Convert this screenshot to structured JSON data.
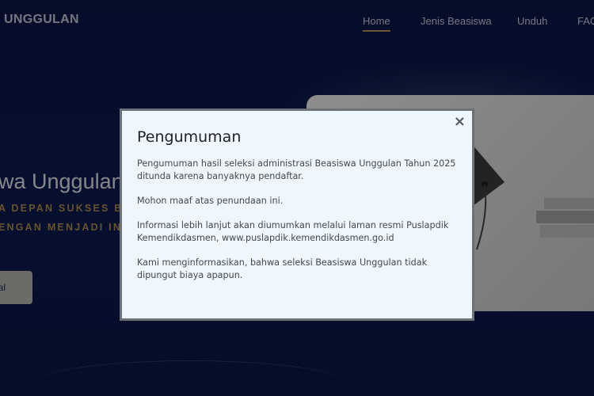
{
  "header": {
    "brand": "UNGGULAN",
    "nav": [
      {
        "label": "Home",
        "active": true
      },
      {
        "label": "Jenis Beasiswa",
        "active": false
      },
      {
        "label": "Unduh",
        "active": false
      },
      {
        "label": "FAQ",
        "active": false
      }
    ]
  },
  "hero": {
    "title": "wa Unggulan",
    "subtitle_line1": "A DEPAN SUKSES BERS",
    "subtitle_line2": "ENGAN MENJADI INSA",
    "button_label": "al"
  },
  "modal": {
    "title": "Pengumuman",
    "close_symbol": "×",
    "paragraphs": [
      "Pengumuman hasil seleksi administrasi Beasiswa Unggulan Tahun 2025 ditunda karena banyaknya pendaftar.",
      "Mohon maaf atas penundaan ini.",
      "Informasi lebih lanjut akan diumumkan melalui laman resmi Puslapdik Kemendikdasmen, www.puslapdik.kemendikdasmen.go.id",
      "Kami menginformasikan, bahwa seleksi Beasiswa Unggulan tidak dipungut biaya apapun."
    ]
  },
  "colors": {
    "background": "#0b1a4d",
    "accent_gold": "#b28f4f",
    "modal_bg": "#eef6fe",
    "modal_border": "#6e7176"
  }
}
